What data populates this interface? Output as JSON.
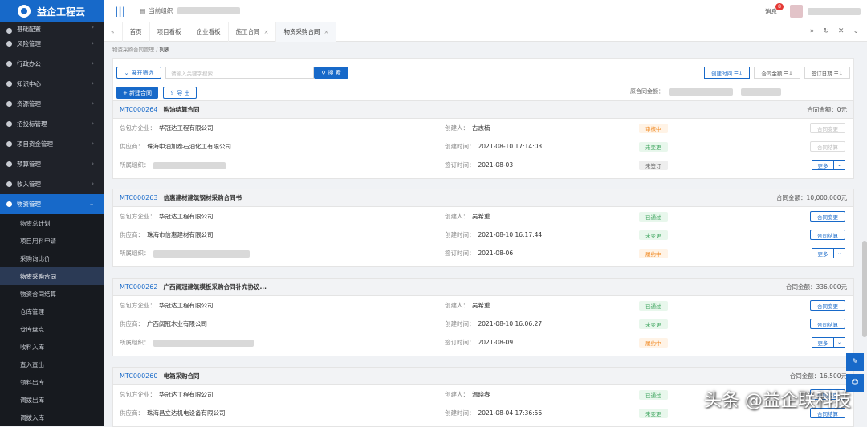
{
  "app": {
    "logo_text": "益企工程云"
  },
  "sidebar": {
    "items": [
      {
        "label": "基础配置"
      },
      {
        "label": "风险管理"
      },
      {
        "label": "行政办公"
      },
      {
        "label": "知识中心"
      },
      {
        "label": "资源管理"
      },
      {
        "label": "招投标管理"
      },
      {
        "label": "项目资金管理"
      },
      {
        "label": "预算管理"
      },
      {
        "label": "收入管理"
      },
      {
        "label": "物资管理"
      }
    ],
    "sub_items": [
      {
        "label": "物资总计划"
      },
      {
        "label": "项目用料申请"
      },
      {
        "label": "采购询比价"
      },
      {
        "label": "物资采购合同"
      },
      {
        "label": "物资合同结算"
      },
      {
        "label": "仓库管理"
      },
      {
        "label": "仓库盘点"
      },
      {
        "label": "收料入库"
      },
      {
        "label": "直入直出"
      },
      {
        "label": "领料出库"
      },
      {
        "label": "调拨出库"
      },
      {
        "label": "调拨入库"
      }
    ]
  },
  "topbar": {
    "current_org_label": "当前组织",
    "msg_label": "消息",
    "msg_count": "8"
  },
  "tabs": [
    {
      "label": "首页"
    },
    {
      "label": "项目看板"
    },
    {
      "label": "企业看板"
    },
    {
      "label": "施工合同"
    },
    {
      "label": "物资采购合同"
    }
  ],
  "breadcrumb": {
    "parent": "物资采购合同管理",
    "current": "列表"
  },
  "filter": {
    "expand_label": "展开筛选",
    "search_placeholder": "请输入关键字搜索",
    "search_btn": "搜 索",
    "new_btn": "+ 新建合同",
    "export_btn": "导 出",
    "sorts": [
      "创建时间 ☰↓",
      "合同金额 ☰↓",
      "签订日期 ☰↓"
    ],
    "total_label": "原合同金额："
  },
  "labels": {
    "org": "总包方企业：",
    "supplier": "供应商：",
    "dept": "所属组织：",
    "creator": "创建人：",
    "created": "创建时间：",
    "signed": "签订时间：",
    "amount": "合同金额：",
    "change": "合同变更",
    "settle": "合同结算",
    "more": "更多"
  },
  "contracts": [
    {
      "no": "MTC000264",
      "name": "购油结算合同",
      "amount": "0元",
      "org": "华冠达工程有限公司",
      "supplier": "珠海中油加泰石油化工有限公司",
      "creator": "古志楠",
      "created": "2021-08-10 17:14:03",
      "signed": "2021-08-03",
      "status1": "审核中",
      "status2": "未变更",
      "status3": "未签订"
    },
    {
      "no": "MTC000263",
      "name": "信惠建材建筑钢材采购合同书",
      "amount": "10,000,000元",
      "org": "华冠达工程有限公司",
      "supplier": "珠海市信惠建材有限公司",
      "creator": "吴希重",
      "created": "2021-08-10 16:17:44",
      "signed": "2021-08-06",
      "status1": "已通过",
      "status2": "未变更",
      "status3": "履约中"
    },
    {
      "no": "MTC000262",
      "name": "广西阔冠建筑模板采购合同补充协议...",
      "amount": "336,000元",
      "org": "华冠达工程有限公司",
      "supplier": "广西阔冠木业有限公司",
      "creator": "吴希重",
      "created": "2021-08-10 16:06:27",
      "signed": "2021-08-09",
      "status1": "已通过",
      "status2": "未变更",
      "status3": "履约中"
    },
    {
      "no": "MTC000260",
      "name": "电箱采购合同",
      "amount": "16,500元",
      "org": "华冠达工程有限公司",
      "supplier": "珠海昌立达机电设备有限公司",
      "creator": "温晓春",
      "created": "2021-08-04 17:36:56",
      "status1": "已通过",
      "status2": "未变更"
    }
  ],
  "watermark": "头条 @益企联科技",
  "colors": {
    "accent": "#1769c9",
    "sidebar_bg": "#1f2229"
  }
}
